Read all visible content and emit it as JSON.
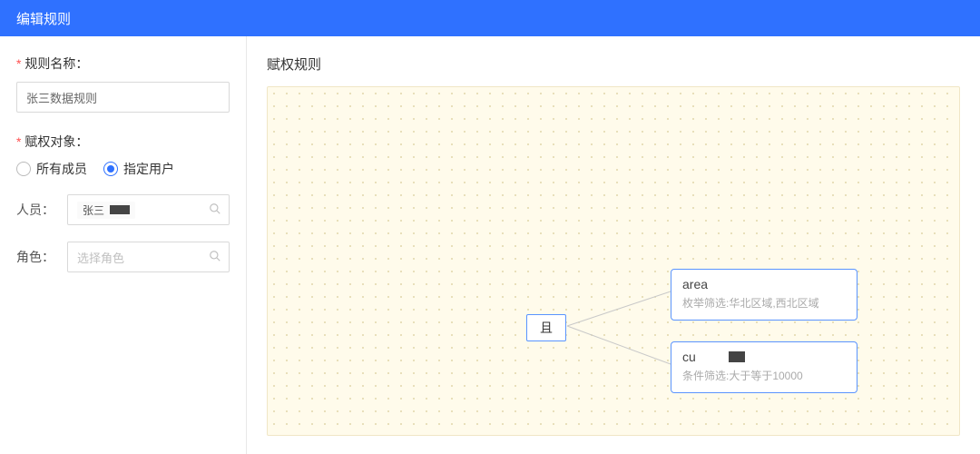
{
  "header": {
    "title": "编辑规则"
  },
  "form": {
    "rule_name_label": "规则名称：",
    "rule_name_value": "张三数据规则",
    "scope_label": "赋权对象：",
    "scope_options": {
      "all": "所有成员",
      "specific": "指定用户"
    },
    "scope_selected": "specific",
    "person_label": "人员：",
    "person_tag": "张三",
    "role_label": "角色：",
    "role_placeholder": "选择角色"
  },
  "rules": {
    "section_title": "赋权规则",
    "operator": "且",
    "conditions": [
      {
        "field": "area",
        "summary": "枚举筛选:华北区域,西北区域"
      },
      {
        "field": "cu",
        "summary": "条件筛选:大于等于10000"
      }
    ]
  }
}
